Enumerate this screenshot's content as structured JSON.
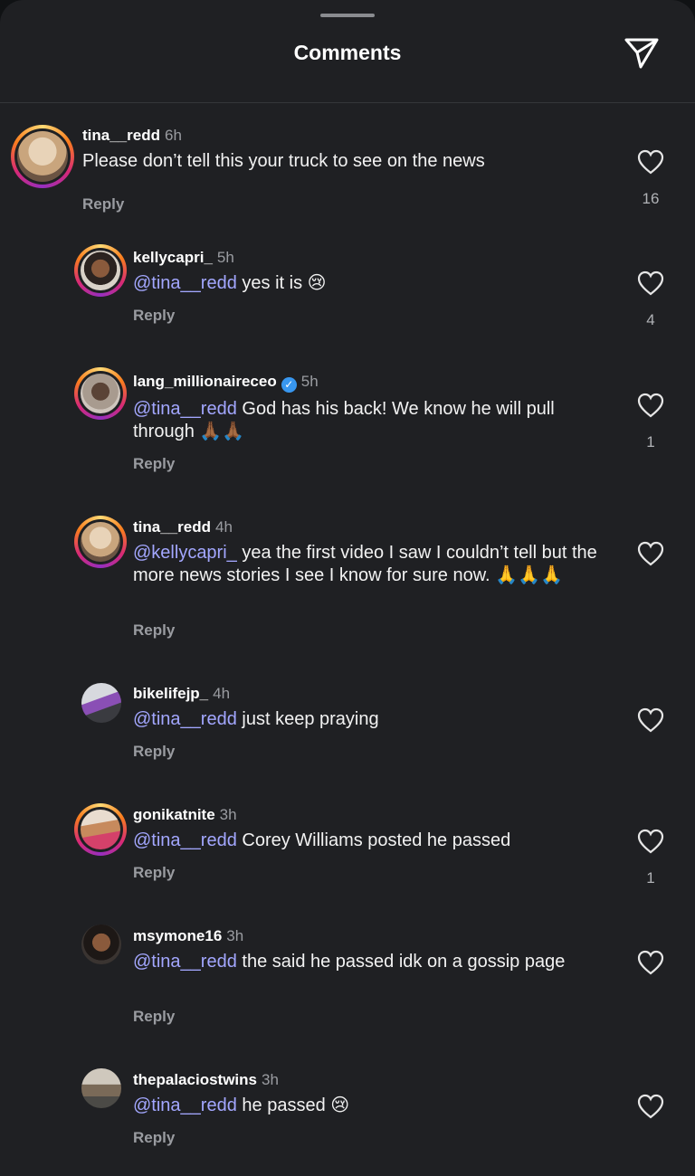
{
  "header": {
    "title": "Comments",
    "send_icon": "paper-plane-icon"
  },
  "comments": [
    {
      "username": "tina__redd",
      "time": "6h",
      "mention": "",
      "text": "Please don’t tell this your truck to see on the news",
      "emoji": "",
      "reply_label": "Reply",
      "likes": "16",
      "verified": false
    },
    {
      "username": "kellycapri_",
      "time": "5h",
      "mention": "@tina__redd",
      "text": "yes it is",
      "emoji": "😢",
      "reply_label": "Reply",
      "likes": "4",
      "verified": false
    },
    {
      "username": "lang_millionaireceo",
      "time": "5h",
      "mention": "@tina__redd",
      "text": "God has his back! We know he will pull through",
      "emoji": "🙏🏾🙏🏾",
      "reply_label": "Reply",
      "likes": "1",
      "verified": true
    },
    {
      "username": "tina__redd",
      "time": "4h",
      "mention": "@kellycapri_",
      "text": "yea the first video I saw I couldn’t tell but the more news stories I see I know for sure now.",
      "emoji": "🙏🙏🙏",
      "reply_label": "Reply",
      "likes": "",
      "verified": false
    },
    {
      "username": "bikelifejp_",
      "time": "4h",
      "mention": "@tina__redd",
      "text": "just keep praying",
      "emoji": "",
      "reply_label": "Reply",
      "likes": "",
      "verified": false
    },
    {
      "username": "gonikatnite",
      "time": "3h",
      "mention": "@tina__redd",
      "text": "Corey Williams posted he passed",
      "emoji": "",
      "reply_label": "Reply",
      "likes": "1",
      "verified": false
    },
    {
      "username": "msymone16",
      "time": "3h",
      "mention": "@tina__redd",
      "text": "the said he passed idk on a gossip page",
      "emoji": "",
      "reply_label": "Reply",
      "likes": "",
      "verified": false
    },
    {
      "username": "thepalaciostwins",
      "time": "3h",
      "mention": "@tina__redd",
      "text": "he passed",
      "emoji": "😢",
      "reply_label": "Reply",
      "likes": "",
      "verified": false
    }
  ],
  "colors": {
    "background": "#1f2023",
    "mention": "#a3a7ff",
    "meta": "#9a9ca1",
    "verified": "#3897f0"
  }
}
